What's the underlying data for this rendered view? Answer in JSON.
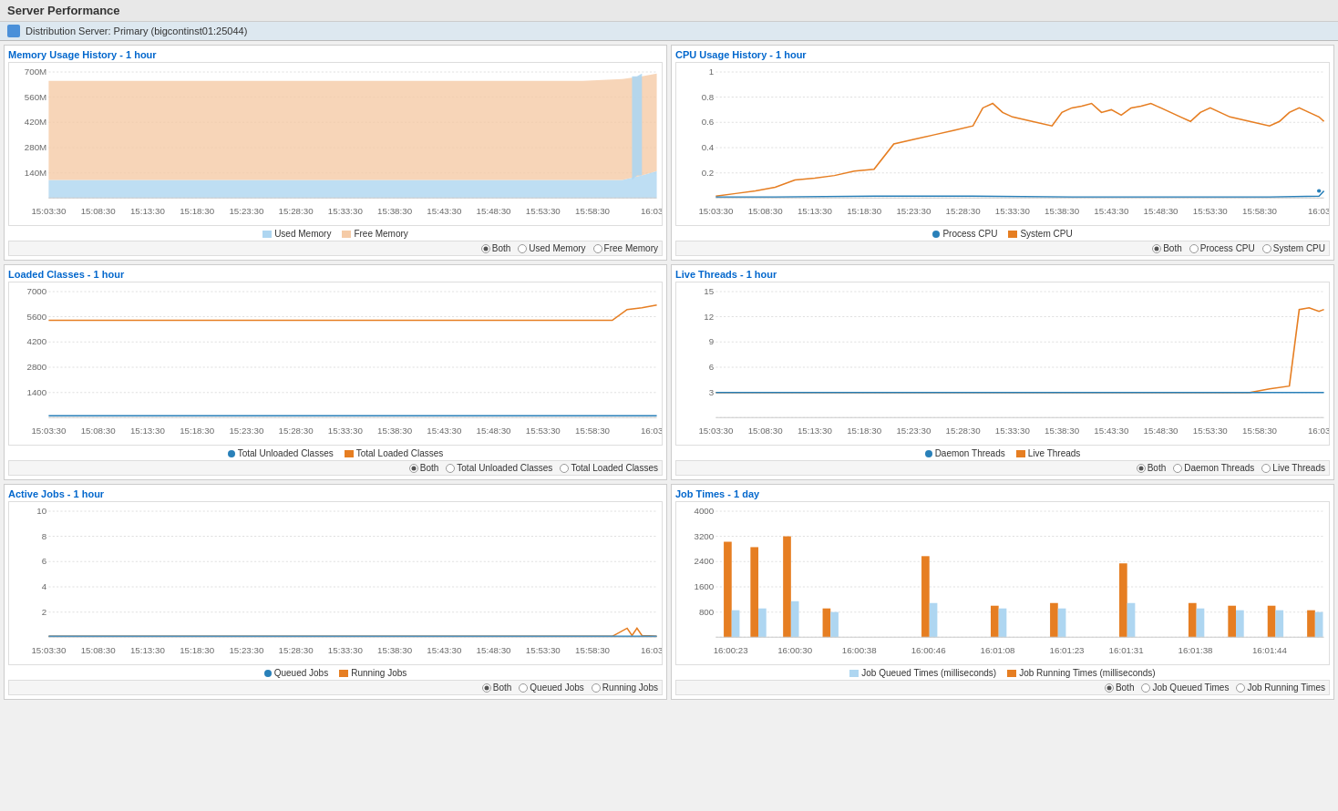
{
  "header": {
    "title": "Server Performance",
    "server_label": "Distribution Server: Primary (bigcontinst01:25044)"
  },
  "charts": {
    "memory": {
      "title": "Memory Usage History - ",
      "timespan": "1 hour",
      "y_labels": [
        "700M",
        "560M",
        "420M",
        "280M",
        "140M"
      ],
      "x_labels": [
        "15:03:30",
        "15:08:30",
        "15:13:30",
        "15:18:30",
        "15:23:30",
        "15:28:30",
        "15:33:30",
        "15:38:30",
        "15:43:30",
        "15:48:30",
        "15:53:30",
        "15:58:30",
        "16:03"
      ],
      "legend_used": "Used Memory",
      "legend_free": "Free Memory",
      "radio_both": "Both",
      "radio_used": "Used Memory",
      "radio_free": "Free Memory"
    },
    "cpu": {
      "title": "CPU Usage History - ",
      "timespan": "1 hour",
      "y_labels": [
        "1",
        "0.8",
        "0.6",
        "0.4",
        "0.2"
      ],
      "x_labels": [
        "15:03:30",
        "15:08:30",
        "15:13:30",
        "15:18:30",
        "15:23:30",
        "15:28:30",
        "15:33:30",
        "15:38:30",
        "15:43:30",
        "15:48:30",
        "15:53:30",
        "15:58:30",
        "16:03"
      ],
      "legend_process": "Process CPU",
      "legend_system": "System CPU",
      "radio_both": "Both",
      "radio_process": "Process CPU",
      "radio_system": "System CPU"
    },
    "classes": {
      "title": "Loaded Classes - ",
      "timespan": "1 hour",
      "y_labels": [
        "7000",
        "5600",
        "4200",
        "2800",
        "1400"
      ],
      "x_labels": [
        "15:03:30",
        "15:08:30",
        "15:13:30",
        "15:18:30",
        "15:23:30",
        "15:28:30",
        "15:33:30",
        "15:38:30",
        "15:43:30",
        "15:48:30",
        "15:53:30",
        "15:58:30",
        "16:03"
      ],
      "legend_unloaded": "Total Unloaded Classes",
      "legend_loaded": "Total Loaded Classes",
      "radio_both": "Both",
      "radio_unloaded": "Total Unloaded Classes",
      "radio_loaded": "Total Loaded Classes"
    },
    "threads": {
      "title": "Live Threads - ",
      "timespan": "1 hour",
      "y_labels": [
        "15",
        "12",
        "9",
        "6",
        "3"
      ],
      "x_labels": [
        "15:03:30",
        "15:08:30",
        "15:13:30",
        "15:18:30",
        "15:23:30",
        "15:28:30",
        "15:33:30",
        "15:38:30",
        "15:43:30",
        "15:48:30",
        "15:53:30",
        "15:58:30",
        "16:03"
      ],
      "legend_daemon": "Daemon Threads",
      "legend_live": "Live Threads",
      "radio_both": "Both",
      "radio_daemon": "Daemon Threads",
      "radio_live": "Live Threads"
    },
    "activejobs": {
      "title": "Active Jobs - ",
      "timespan": "1 hour",
      "y_labels": [
        "10",
        "8",
        "6",
        "4",
        "2"
      ],
      "x_labels": [
        "15:03:30",
        "15:08:30",
        "15:13:30",
        "15:18:30",
        "15:23:30",
        "15:28:30",
        "15:33:30",
        "15:38:30",
        "15:43:30",
        "15:48:30",
        "15:53:30",
        "15:58:30",
        "16:03"
      ],
      "legend_queued": "Queued Jobs",
      "legend_running": "Running Jobs",
      "radio_both": "Both",
      "radio_queued": "Queued Jobs",
      "radio_running": "Running Jobs"
    },
    "jobtimes": {
      "title": "Job Times - ",
      "timespan": "1 day",
      "y_labels": [
        "4000",
        "3200",
        "2400",
        "1600",
        "800"
      ],
      "x_labels": [
        "16:00:23",
        "16:00:30",
        "16:00:38",
        "16:00:46",
        "16:01:08",
        "16:01:23",
        "16:01:31",
        "16:01:38",
        "16:01:44"
      ],
      "legend_queued": "Job Queued Times (milliseconds)",
      "legend_running": "Job Running Times (milliseconds)",
      "radio_both": "Both",
      "radio_queued": "Job Queued Times",
      "radio_running": "Job Running Times"
    }
  },
  "colors": {
    "used_memory": "#aed6f1",
    "free_memory": "#f5cba7",
    "process_cpu": "#2980b9",
    "system_cpu": "#e67e22",
    "loaded_classes": "#e67e22",
    "unloaded_classes": "#2980b9",
    "live_threads": "#e67e22",
    "daemon_threads": "#2980b9",
    "queued_jobs": "#2980b9",
    "running_jobs": "#e67e22",
    "job_queued_times": "#aed6f1",
    "job_running_times": "#e67e22"
  }
}
